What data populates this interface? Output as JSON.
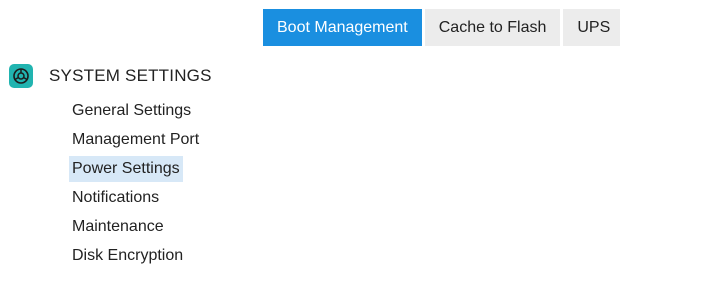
{
  "tabs": [
    {
      "label": "Boot Management",
      "active": true
    },
    {
      "label": "Cache to Flash",
      "active": false
    },
    {
      "label": "UPS",
      "active": false
    }
  ],
  "section": {
    "icon": "system-settings-icon",
    "title": "SYSTEM SETTINGS",
    "items": [
      {
        "label": "General Settings",
        "selected": false
      },
      {
        "label": "Management Port",
        "selected": false
      },
      {
        "label": "Power Settings",
        "selected": true
      },
      {
        "label": "Notifications",
        "selected": false
      },
      {
        "label": "Maintenance",
        "selected": false
      },
      {
        "label": "Disk Encryption",
        "selected": false
      }
    ]
  },
  "colors": {
    "tab_active_bg": "#1a8fe0",
    "tab_bg": "#ececec",
    "icon_bg": "#21b4b0",
    "selected_bg": "#d7e8f7"
  }
}
